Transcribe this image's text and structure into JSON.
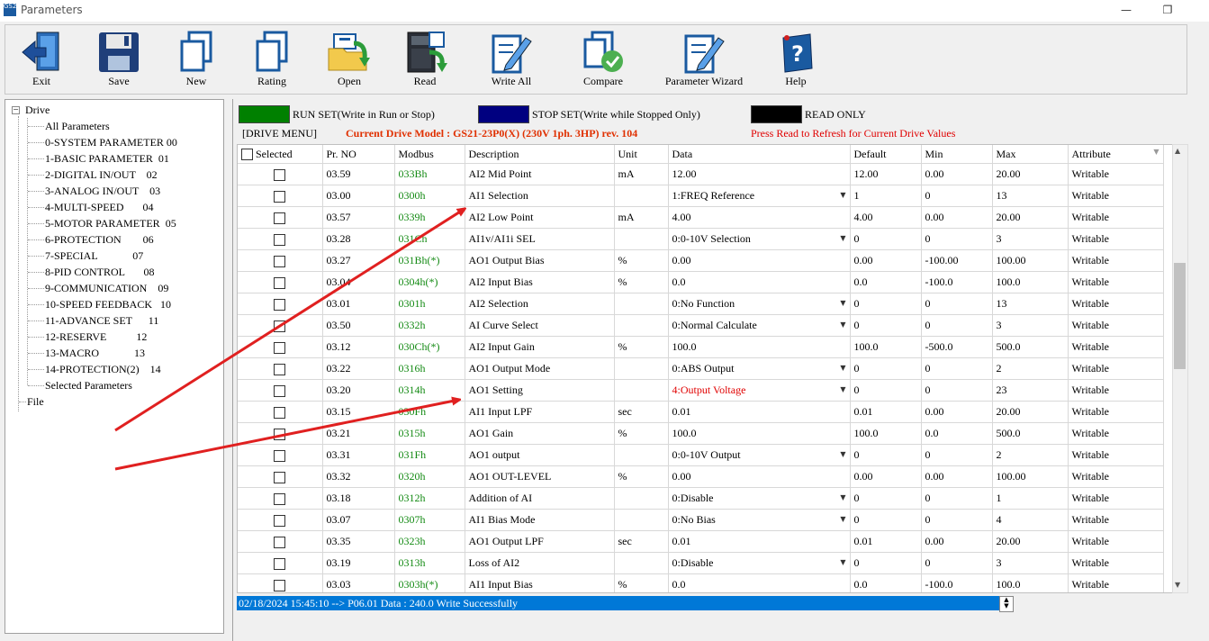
{
  "window": {
    "title": "Parameters",
    "app_icon_text": "GS2",
    "minimize": "—",
    "restore": "❐"
  },
  "toolbar": [
    {
      "label": "Exit",
      "icon": "exit-icon"
    },
    {
      "label": "Save",
      "icon": "save-icon"
    },
    {
      "label": "New",
      "icon": "new-icon"
    },
    {
      "label": "Rating",
      "icon": "rating-icon"
    },
    {
      "label": "Open",
      "icon": "open-icon"
    },
    {
      "label": "Read",
      "icon": "read-icon"
    },
    {
      "label": "Write All",
      "icon": "write-all-icon"
    },
    {
      "label": "Compare",
      "icon": "compare-icon"
    },
    {
      "label": "Parameter Wizard",
      "icon": "parameter-wizard-icon"
    },
    {
      "label": "Help",
      "icon": "help-icon"
    }
  ],
  "tree": {
    "root": "Drive",
    "root_toggle": "−",
    "items": [
      "All Parameters",
      "0-SYSTEM PARAMETER 00",
      "1-BASIC PARAMETER  01",
      "2-DIGITAL IN/OUT    02",
      "3-ANALOG IN/OUT    03",
      "4-MULTI-SPEED       04",
      "5-MOTOR PARAMETER  05",
      "6-PROTECTION        06",
      "7-SPECIAL             07",
      "8-PID CONTROL       08",
      "9-COMMUNICATION    09",
      "10-SPEED FEEDBACK   10",
      "11-ADVANCE SET      11",
      "12-RESERVE           12",
      "13-MACRO             13",
      "14-PROTECTION(2)    14",
      "Selected Parameters"
    ],
    "file": "File"
  },
  "legend": {
    "run_set": "RUN SET(Write in Run or Stop)",
    "stop_set": "STOP SET(Write while Stopped Only)",
    "read_only": "READ ONLY",
    "run_color": "#008000",
    "stop_color": "#000080",
    "read_color": "#000000"
  },
  "info": {
    "drive_menu": "[DRIVE MENU]",
    "drive_model": "Current Drive Model : GS21-23P0(X) (230V 1ph. 3HP) rev. 104",
    "press_read": "Press Read to Refresh for Current Drive Values"
  },
  "columns": [
    "Selected",
    "Pr. NO",
    "Modbus",
    "Description",
    "Unit",
    "Data",
    "Default",
    "Min",
    "Max",
    "Attribute"
  ],
  "rows": [
    {
      "pr": "03.59",
      "modbus": "033Bh",
      "desc": "AI2 Mid Point",
      "unit": "mA",
      "data": "12.00",
      "dd": false,
      "def": "12.00",
      "min": "0.00",
      "max": "20.00",
      "attr": "Writable"
    },
    {
      "pr": "03.00",
      "modbus": "0300h",
      "desc": "AI1 Selection",
      "unit": "",
      "data": "1:FREQ Reference",
      "dd": true,
      "def": "1",
      "min": "0",
      "max": "13",
      "attr": "Writable"
    },
    {
      "pr": "03.57",
      "modbus": "0339h",
      "desc": "AI2 Low Point",
      "unit": "mA",
      "data": "4.00",
      "dd": false,
      "def": "4.00",
      "min": "0.00",
      "max": "20.00",
      "attr": "Writable"
    },
    {
      "pr": "03.28",
      "modbus": "031Ch",
      "desc": "AI1v/AI1i SEL",
      "unit": "",
      "data": "0:0-10V Selection",
      "dd": true,
      "def": "0",
      "min": "0",
      "max": "3",
      "attr": "Writable"
    },
    {
      "pr": "03.27",
      "modbus": "031Bh(*)",
      "desc": "AO1 Output Bias",
      "unit": "%",
      "data": "0.00",
      "dd": false,
      "def": "0.00",
      "min": "-100.00",
      "max": "100.00",
      "attr": "Writable"
    },
    {
      "pr": "03.04",
      "modbus": "0304h(*)",
      "desc": "AI2 Input Bias",
      "unit": "%",
      "data": "0.0",
      "dd": false,
      "def": "0.0",
      "min": "-100.0",
      "max": "100.0",
      "attr": "Writable"
    },
    {
      "pr": "03.01",
      "modbus": "0301h",
      "desc": "AI2 Selection",
      "unit": "",
      "data": "0:No Function",
      "dd": true,
      "def": "0",
      "min": "0",
      "max": "13",
      "attr": "Writable"
    },
    {
      "pr": "03.50",
      "modbus": "0332h",
      "desc": "AI Curve Select",
      "unit": "",
      "data": "0:Normal Calculate",
      "dd": true,
      "def": "0",
      "min": "0",
      "max": "3",
      "attr": "Writable"
    },
    {
      "pr": "03.12",
      "modbus": "030Ch(*)",
      "desc": "AI2 Input Gain",
      "unit": "%",
      "data": "100.0",
      "dd": false,
      "def": "100.0",
      "min": "-500.0",
      "max": "500.0",
      "attr": "Writable"
    },
    {
      "pr": "03.22",
      "modbus": "0316h",
      "desc": "AO1 Output Mode",
      "unit": "",
      "data": "0:ABS Output",
      "dd": true,
      "def": "0",
      "min": "0",
      "max": "2",
      "attr": "Writable"
    },
    {
      "pr": "03.20",
      "modbus": "0314h",
      "desc": "AO1 Setting",
      "unit": "",
      "data": "4:Output Voltage",
      "dd": true,
      "red": true,
      "def": "0",
      "min": "0",
      "max": "23",
      "attr": "Writable"
    },
    {
      "pr": "03.15",
      "modbus": "030Fh",
      "desc": "AI1 Input LPF",
      "unit": "sec",
      "data": "0.01",
      "dd": false,
      "def": "0.01",
      "min": "0.00",
      "max": "20.00",
      "attr": "Writable"
    },
    {
      "pr": "03.21",
      "modbus": "0315h",
      "desc": "AO1 Gain",
      "unit": "%",
      "data": "100.0",
      "dd": false,
      "def": "100.0",
      "min": "0.0",
      "max": "500.0",
      "attr": "Writable"
    },
    {
      "pr": "03.31",
      "modbus": "031Fh",
      "desc": "AO1 output",
      "unit": "",
      "data": "0:0-10V Output",
      "dd": true,
      "def": "0",
      "min": "0",
      "max": "2",
      "attr": "Writable"
    },
    {
      "pr": "03.32",
      "modbus": "0320h",
      "desc": "AO1 OUT-LEVEL",
      "unit": "%",
      "data": "0.00",
      "dd": false,
      "def": "0.00",
      "min": "0.00",
      "max": "100.00",
      "attr": "Writable"
    },
    {
      "pr": "03.18",
      "modbus": "0312h",
      "desc": "Addition of AI",
      "unit": "",
      "data": "0:Disable",
      "dd": true,
      "def": "0",
      "min": "0",
      "max": "1",
      "attr": "Writable"
    },
    {
      "pr": "03.07",
      "modbus": "0307h",
      "desc": "AI1 Bias Mode",
      "unit": "",
      "data": "0:No Bias",
      "dd": true,
      "def": "0",
      "min": "0",
      "max": "4",
      "attr": "Writable"
    },
    {
      "pr": "03.35",
      "modbus": "0323h",
      "desc": "AO1 Output LPF",
      "unit": "sec",
      "data": "0.01",
      "dd": false,
      "def": "0.01",
      "min": "0.00",
      "max": "20.00",
      "attr": "Writable"
    },
    {
      "pr": "03.19",
      "modbus": "0313h",
      "desc": "Loss of AI2",
      "unit": "",
      "data": "0:Disable",
      "dd": true,
      "def": "0",
      "min": "0",
      "max": "3",
      "attr": "Writable"
    },
    {
      "pr": "03.03",
      "modbus": "0303h(*)",
      "desc": "AI1 Input Bias",
      "unit": "%",
      "data": "0.0",
      "dd": false,
      "def": "0.0",
      "min": "-100.0",
      "max": "100.0",
      "attr": "Writable"
    }
  ],
  "status": "02/18/2024 15:45:10 --> P06.01 Data : 240.0 Write Successfully",
  "colors": {
    "accent": "#0078d7",
    "modbus_green": "#138a13",
    "annotation_red": "#e02020",
    "model_text": "#e03000"
  }
}
